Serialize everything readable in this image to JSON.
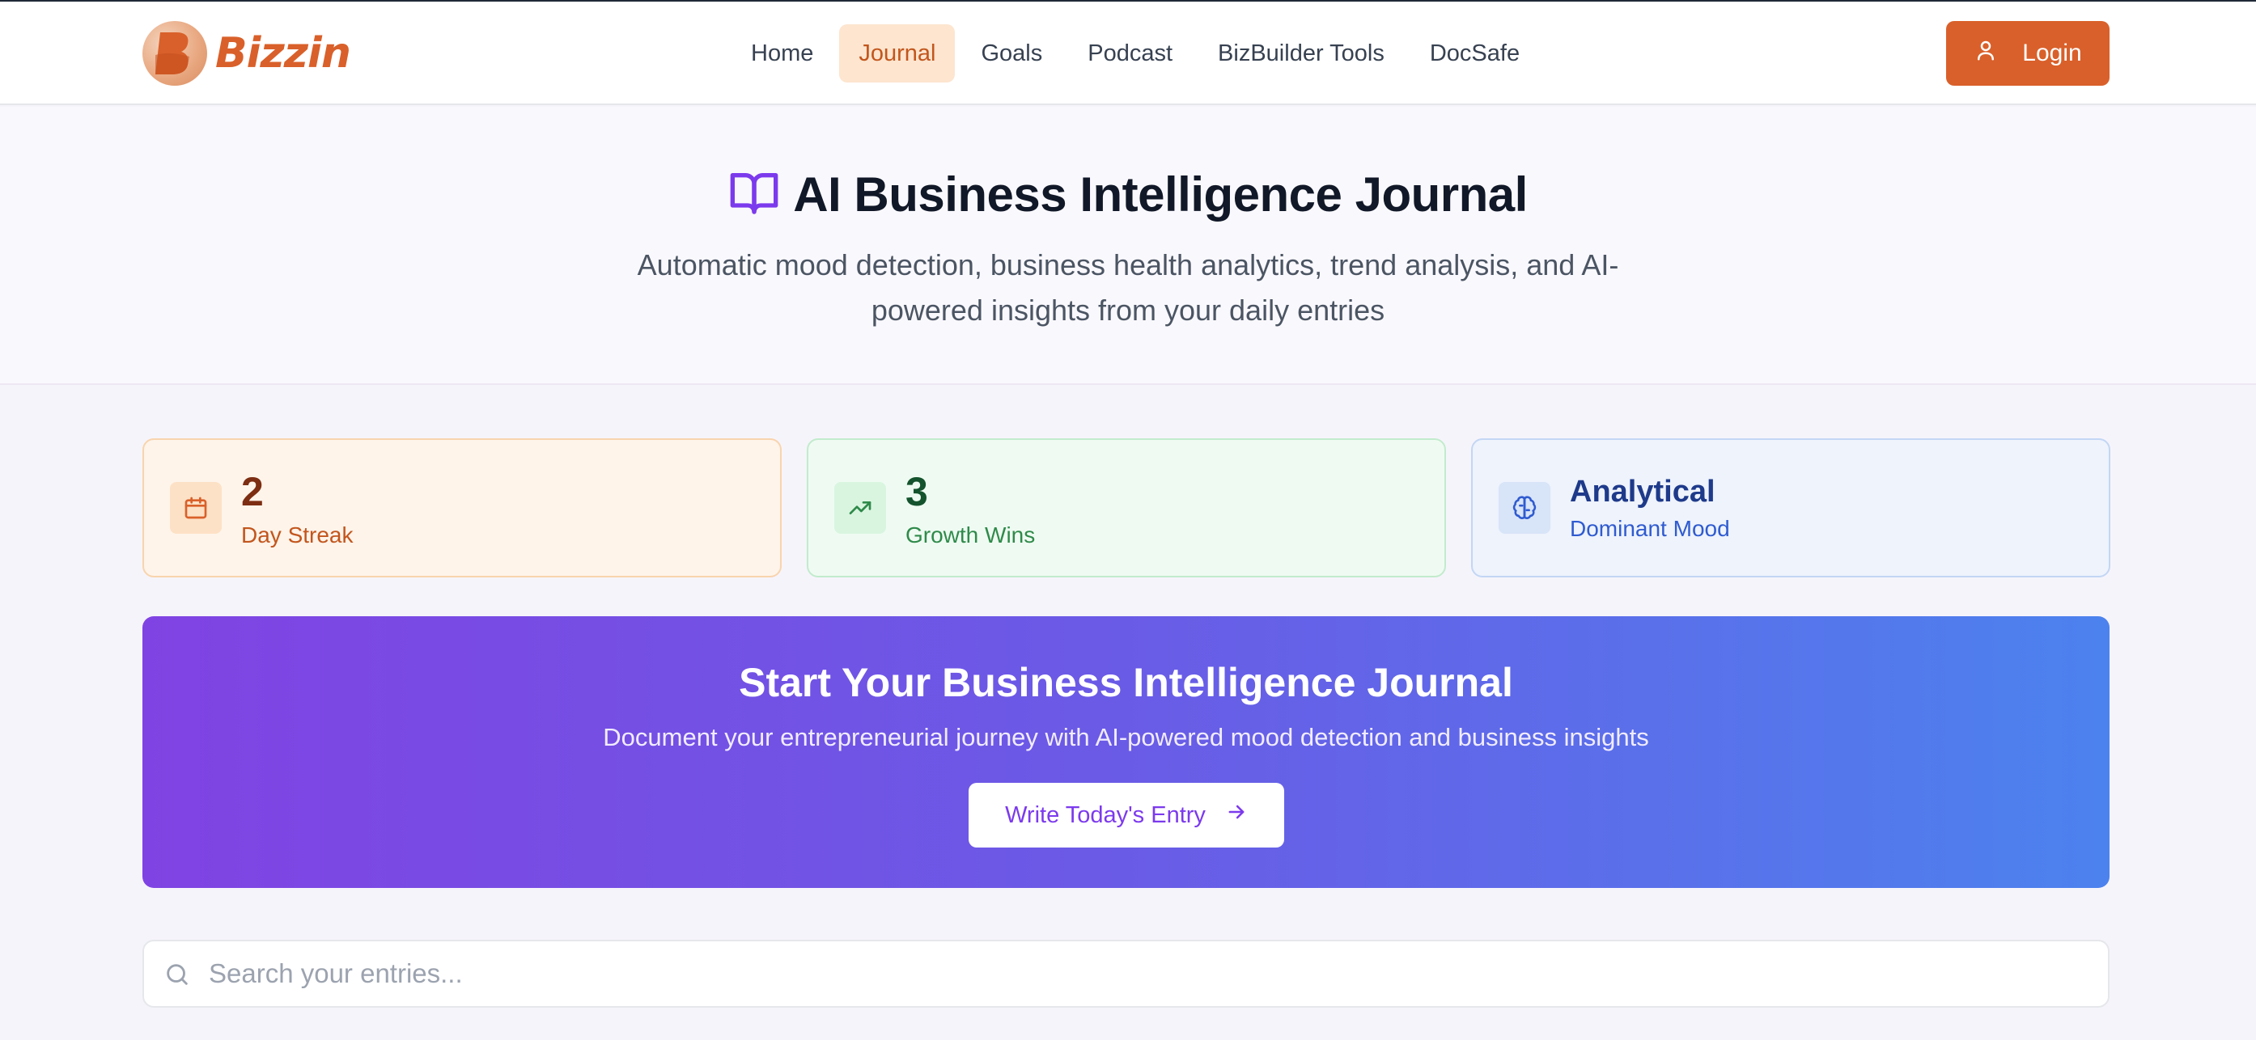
{
  "brand": {
    "name": "Bizzin",
    "logo_letter": "B"
  },
  "nav": {
    "items": [
      {
        "label": "Home",
        "active": false
      },
      {
        "label": "Journal",
        "active": true
      },
      {
        "label": "Goals",
        "active": false
      },
      {
        "label": "Podcast",
        "active": false
      },
      {
        "label": "BizBuilder Tools",
        "active": false
      },
      {
        "label": "DocSafe",
        "active": false
      }
    ],
    "login_label": "Login"
  },
  "hero": {
    "icon": "book-open-icon",
    "title": "AI Business Intelligence Journal",
    "subtitle": "Automatic mood detection, business health analytics, trend analysis, and AI-powered insights from your daily entries"
  },
  "stats": [
    {
      "icon": "calendar-icon",
      "value": "2",
      "label": "Day Streak",
      "color": "#d9602a"
    },
    {
      "icon": "trending-up-icon",
      "value": "3",
      "label": "Growth Wins",
      "color": "#2f8a4a"
    },
    {
      "icon": "brain-icon",
      "value": "Analytical",
      "label": "Dominant Mood",
      "color": "#2f5bd0"
    }
  ],
  "banner": {
    "title": "Start Your Business Intelligence Journal",
    "subtitle": "Document your entrepreneurial journey with AI-powered mood detection and business insights",
    "button_label": "Write Today's Entry",
    "button_icon": "arrow-right-icon"
  },
  "search": {
    "icon": "search-icon",
    "placeholder": "Search your entries...",
    "value": ""
  },
  "colors": {
    "brand_orange": "#d9602a",
    "accent_purple": "#7c3aed",
    "gradient_start": "#8043e3",
    "gradient_end": "#4c82ee"
  }
}
